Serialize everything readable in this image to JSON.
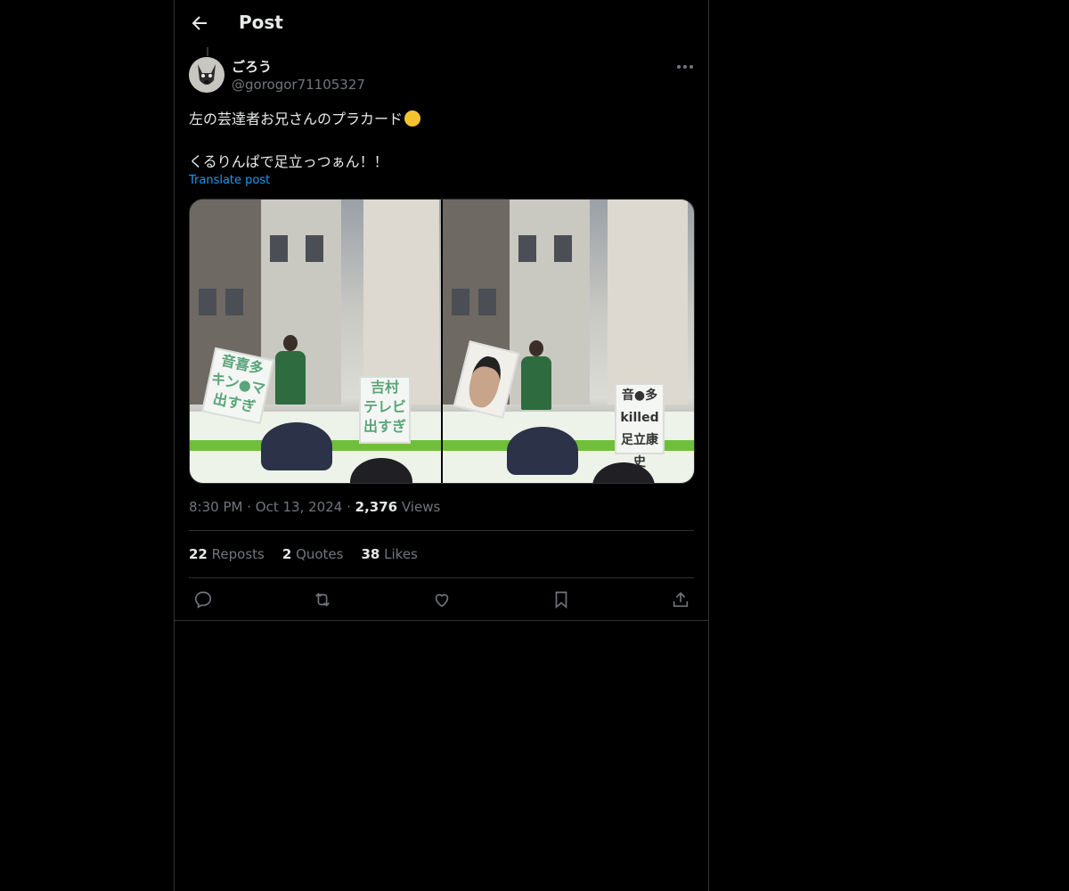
{
  "header": {
    "title": "Post"
  },
  "post": {
    "author_name": "ごろう",
    "author_handle": "@gorogor71105327",
    "text_line1": "左の芸達者お兄さんのプラカード",
    "text_line2": "くるりんぱで足立っつぁん！！",
    "translate_label": "Translate post",
    "time": "8:30 PM",
    "date": "Oct 13, 2024",
    "views_count": "2,376",
    "views_label": "Views",
    "sep": "·"
  },
  "media": {
    "photo1_sign_a": "音喜多\nキン●マ\n出すぎ",
    "photo1_sign_b": "吉村\nテレビ\n出すぎ",
    "photo2_sign": "音●多\nkilled\n足立康史"
  },
  "stats": [
    {
      "count": "22",
      "label": "Reposts"
    },
    {
      "count": "2",
      "label": "Quotes"
    },
    {
      "count": "38",
      "label": "Likes"
    }
  ],
  "icons": [
    "back-arrow-icon",
    "more-icon",
    "reply-icon",
    "retweet-icon",
    "like-icon",
    "bookmark-icon",
    "share-icon"
  ],
  "colors": {
    "background": "#000000",
    "text": "#e7e9ea",
    "muted": "#71767b",
    "link": "#1d9bf0",
    "border": "#2f3336"
  }
}
